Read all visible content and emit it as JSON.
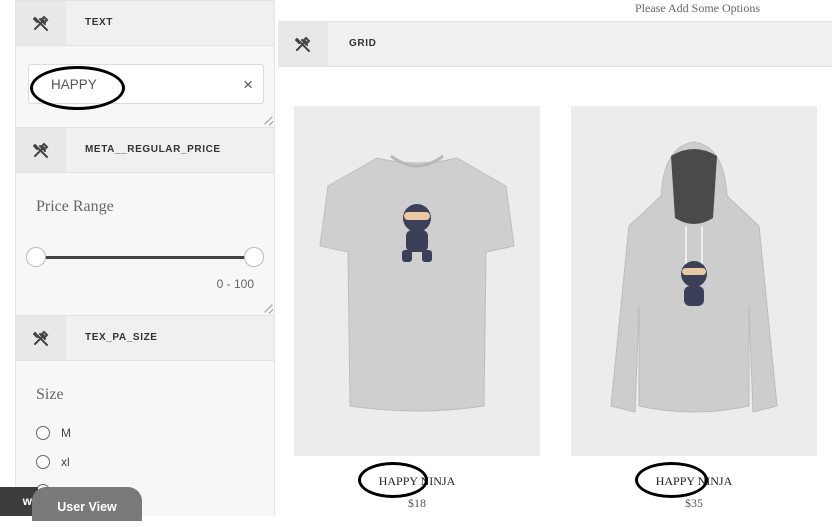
{
  "filters": {
    "text": {
      "header": "TEXT",
      "value": "HAPPY",
      "clear_symbol": "×"
    },
    "price": {
      "header": "META__REGULAR_PRICE",
      "label": "Price Range",
      "min": 0,
      "max": 100,
      "range_text": "0 - 100"
    },
    "size": {
      "header": "TEX_PA_SIZE",
      "label": "Size",
      "options": [
        "M",
        "xl"
      ]
    }
  },
  "view_tabs": {
    "left_partial": "w",
    "user_view": "User View"
  },
  "top_note": "Please Add Some Options",
  "grid": {
    "header": "GRID",
    "products": [
      {
        "title": "HAPPY NINJA",
        "price": "$18",
        "item": "t-shirt"
      },
      {
        "title": "HAPPY NINJA",
        "price": "$35",
        "item": "hoodie"
      }
    ]
  },
  "colors": {
    "annotation": "#000000",
    "track": "#444444",
    "panel": "#f7f7f7",
    "header": "#f0f0f0"
  },
  "icons": {
    "section": "tools-icon",
    "clear": "close-icon"
  }
}
